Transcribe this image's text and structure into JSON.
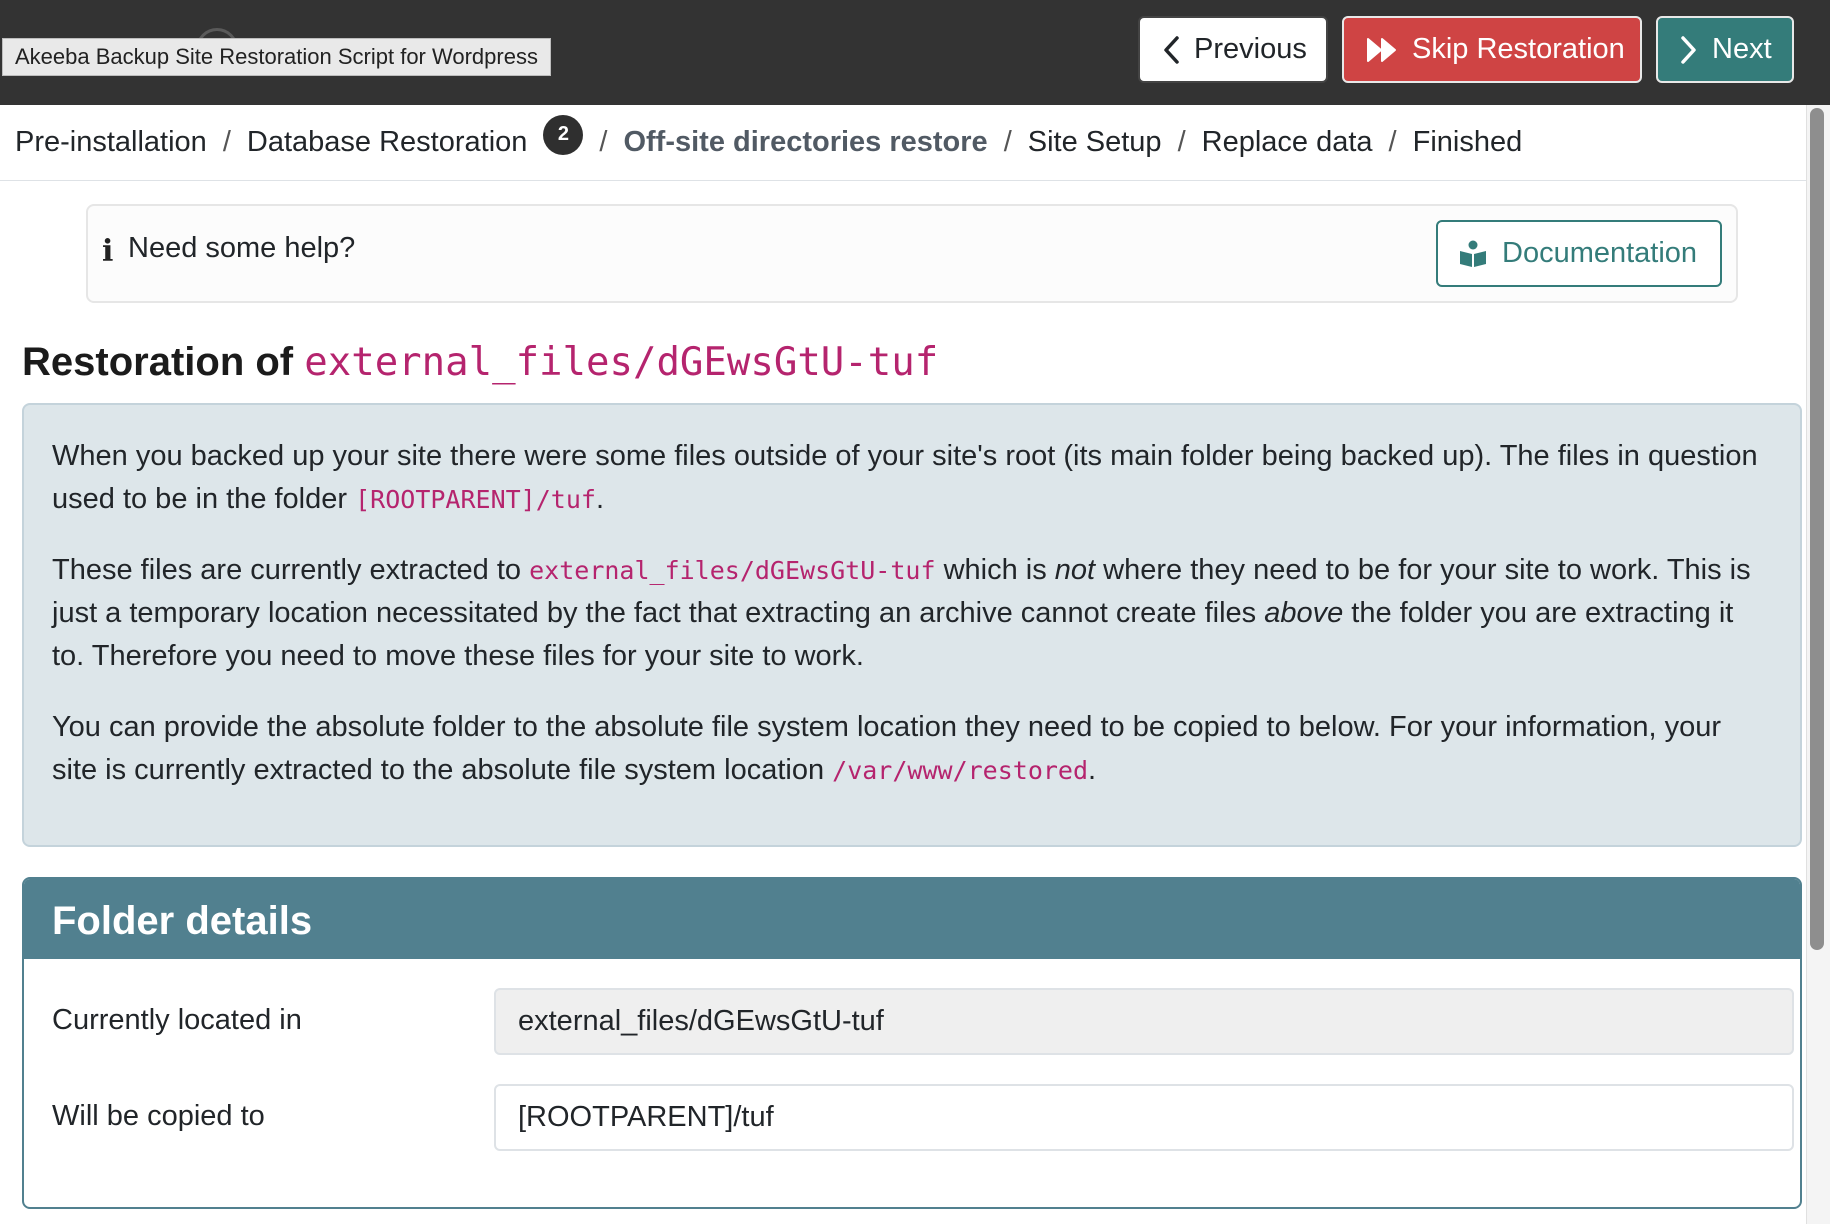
{
  "header": {
    "tooltip": "Akeeba Backup Site Restoration Script for Wordpress",
    "buttons": {
      "previous": "Previous",
      "skip": "Skip Restoration",
      "next": "Next"
    }
  },
  "steps": [
    {
      "label": "Pre-installation"
    },
    {
      "label": "Database Restoration",
      "badge": "2"
    },
    {
      "label": "Off-site directories restore",
      "active": true
    },
    {
      "label": "Site Setup"
    },
    {
      "label": "Replace data"
    },
    {
      "label": "Finished"
    }
  ],
  "separator": "/",
  "help": {
    "icon": "info-icon",
    "text": "Need some help?",
    "button": "Documentation"
  },
  "title": {
    "prefix": "Restoration of",
    "folder": "external_files/dGEwsGtU-tuf"
  },
  "info": {
    "p1_a": "When you backed up your site there were some files outside of your site's root (its main folder being backed up). The files in question used to be in the folder",
    "p1_code": "[ROOTPARENT]/tuf",
    "p1_b": ".",
    "p2_a": "These files are currently extracted to",
    "p2_code": "external_files/dGEwsGtU-tuf",
    "p2_b": "which is",
    "p2_em1": "not",
    "p2_c": "where they need to be for your site to work. This is just a temporary location necessitated by the fact that extracting an archive cannot create files",
    "p2_em2": "above",
    "p2_d": "the folder you are extracting it to. Therefore you need to move these files for your site to work.",
    "p3_a": "You can provide the absolute folder to the absolute file system location they need to be copied to below. For your information, your site is currently extracted to the absolute file system location",
    "p3_code": "/var/www/restored",
    "p3_b": "."
  },
  "folder_details": {
    "heading": "Folder details",
    "current_label": "Currently located in",
    "current_value": "external_files/dGEwsGtU-tuf",
    "target_label": "Will be copied to",
    "target_value": "[ROOTPARENT]/tuf"
  },
  "colors": {
    "header_bg": "#333333",
    "skip_btn": "#cf4444",
    "accent_teal": "#347c7a",
    "card_header": "#51808f",
    "info_bg": "#dde6ea",
    "code": "#b5246e"
  }
}
